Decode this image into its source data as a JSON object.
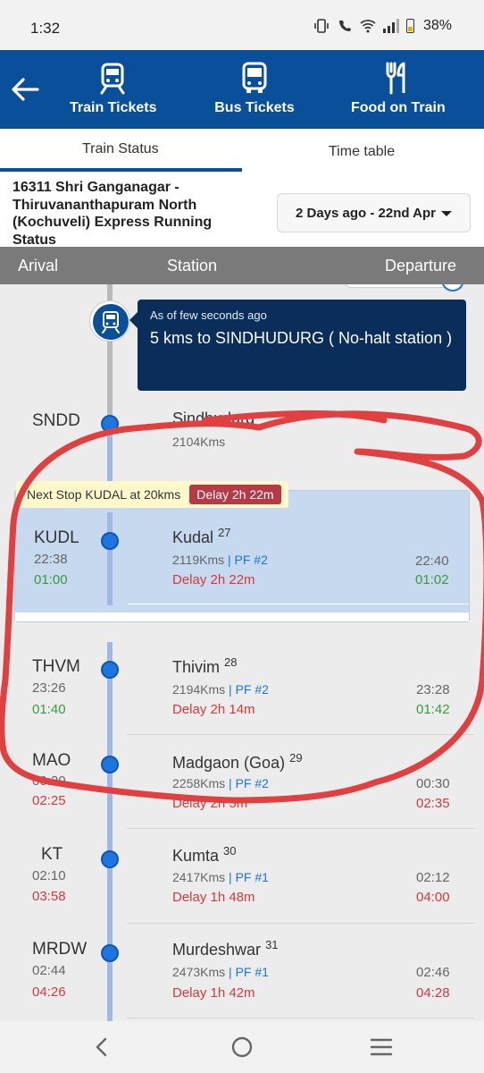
{
  "status_bar": {
    "time": "1:32",
    "battery": "38%"
  },
  "header": {
    "back_icon": "arrow-left-icon",
    "nav": [
      {
        "label": "Train Tickets",
        "icon": "train-icon"
      },
      {
        "label": "Bus Tickets",
        "icon": "bus-icon"
      },
      {
        "label": "Food on Train",
        "icon": "fork-knife-icon"
      }
    ]
  },
  "tabs": {
    "train_status": "Train Status",
    "time_table": "Time table"
  },
  "train": {
    "title": "16311 Shri Ganganagar - Thiruvananthapuram North (Kochuveli) Express Running Status",
    "date": "2 Days ago - 22nd Apr"
  },
  "columns": {
    "arrival": "Arival",
    "station": "Station",
    "departure": "Departure"
  },
  "live": {
    "updated": "As of few seconds ago",
    "message": "5 kms to SINDHUDURG ( No-halt station )"
  },
  "next_stop": {
    "text": "Next Stop KUDAL at 20kms",
    "delay": "Delay 2h 22m"
  },
  "stations": [
    {
      "code": "SNDD",
      "name": "Sindhudurg",
      "num": "",
      "kms": "2104Kms",
      "pf": "",
      "delay": "",
      "arr_sched": "",
      "arr_actual": "",
      "dep_sched": "",
      "dep_actual": ""
    },
    {
      "code": "KUDL",
      "name": "Kudal",
      "num": "27",
      "kms": "2119Kms",
      "pf": "PF #2",
      "delay": "Delay 2h 22m",
      "arr_sched": "22:38",
      "arr_actual": "01:00",
      "dep_sched": "22:40",
      "dep_actual": "01:02"
    },
    {
      "code": "THVM",
      "name": "Thivim",
      "num": "28",
      "kms": "2194Kms",
      "pf": "PF #2",
      "delay": "Delay 2h 14m",
      "arr_sched": "23:26",
      "arr_actual": "01:40",
      "dep_sched": "23:28",
      "dep_actual": "01:42"
    },
    {
      "code": "MAO",
      "name": "Madgaon (Goa)",
      "num": "29",
      "kms": "2258Kms",
      "pf": "PF #2",
      "delay": "Delay 2h 5m",
      "arr_sched": "00:20",
      "arr_actual": "02:25",
      "dep_sched": "00:30",
      "dep_actual": "02:35"
    },
    {
      "code": "KT",
      "name": "Kumta",
      "num": "30",
      "kms": "2417Kms",
      "pf": "PF #1",
      "delay": "Delay 1h 48m",
      "arr_sched": "02:10",
      "arr_actual": "03:58",
      "dep_sched": "02:12",
      "dep_actual": "04:00"
    },
    {
      "code": "MRDW",
      "name": "Murdeshwar",
      "num": "31",
      "kms": "2473Kms",
      "pf": "PF #1",
      "delay": "Delay 1h 42m",
      "arr_sched": "02:44",
      "arr_actual": "04:26",
      "dep_sched": "02:46",
      "dep_actual": "04:28"
    }
  ],
  "pf_separator": " | ",
  "colors": {
    "primary": "#0a4f9a",
    "on_time": "#3a9b3a",
    "delayed": "#d33b3b",
    "annotation": "#e0403f"
  }
}
